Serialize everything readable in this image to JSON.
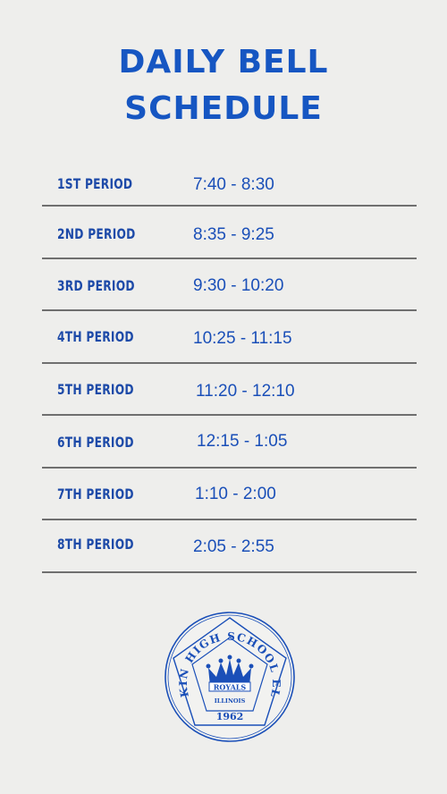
{
  "title": {
    "line1": "DAILY BELL",
    "line2": "SCHEDULE"
  },
  "periods": [
    {
      "label": "1ST PERIOD",
      "time": "7:40 - 8:30"
    },
    {
      "label": "2ND PERIOD",
      "time": "8:35 - 9:25"
    },
    {
      "label": "3RD PERIOD",
      "time": "9:30 - 10:20"
    },
    {
      "label": "4TH PERIOD",
      "time": "10:25 - 11:15"
    },
    {
      "label": "5TH PERIOD",
      "time": "11:20 - 12:10"
    },
    {
      "label": "6TH PERIOD",
      "time": "12:15 - 1:05"
    },
    {
      "label": "7TH PERIOD",
      "time": "1:10 - 2:00"
    },
    {
      "label": "8TH PERIOD",
      "time": "2:05 - 2:55"
    }
  ],
  "seal": {
    "top_text": "LARKIN HIGH SCHOOL ELGIN",
    "banner": "ROYALS",
    "state": "ILLINOIS",
    "year": "1962"
  },
  "colors": {
    "title": "#1656c2",
    "text": "#1a4fb8",
    "divider": "#6f6f6f",
    "background": "#eeeeec"
  }
}
